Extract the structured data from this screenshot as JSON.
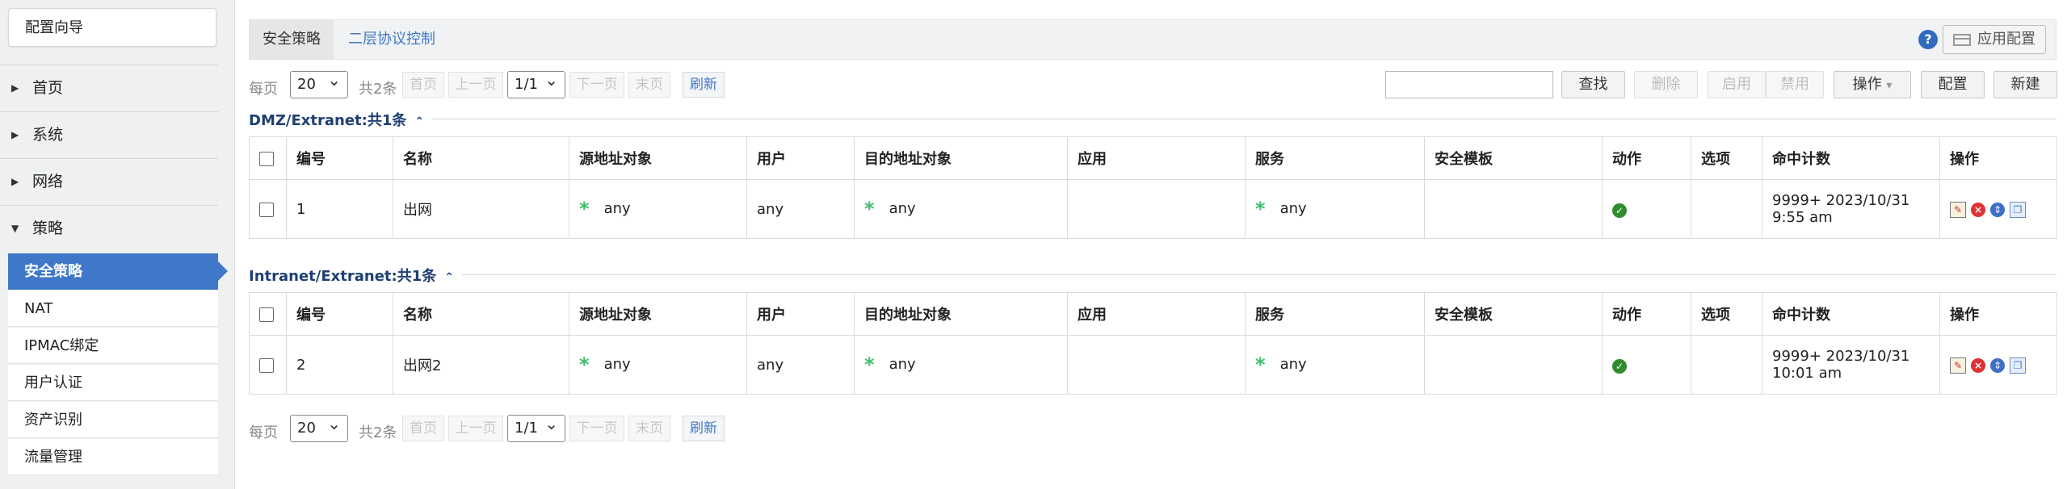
{
  "sidebar": {
    "wizard": "配置向导",
    "items": [
      {
        "label": "首页",
        "arrow": "▶"
      },
      {
        "label": "系统",
        "arrow": "▶"
      },
      {
        "label": "网络",
        "arrow": "▶"
      },
      {
        "label": "策略",
        "arrow": "▼"
      }
    ],
    "subitems": [
      "安全策略",
      "NAT",
      "IPMAC绑定",
      "用户认证",
      "资产识别",
      "流量管理"
    ]
  },
  "tabs": {
    "security_policy": "安全策略",
    "layer2": "二层协议控制"
  },
  "header": {
    "help": "?",
    "apply_config": "应用配置"
  },
  "pager": {
    "per_page_label": "每页",
    "per_page": "20",
    "total": "共2条",
    "first": "首页",
    "prev": "上一页",
    "page": "1/1",
    "next": "下一页",
    "last": "末页",
    "refresh": "刷新"
  },
  "toolbar": {
    "search_value": "",
    "find": "查找",
    "delete": "删除",
    "enable": "启用",
    "disable": "禁用",
    "operation": "操作",
    "operation_arrow": "▾",
    "config": "配置",
    "new": "新建"
  },
  "columns": [
    "编号",
    "名称",
    "源地址对象",
    "用户",
    "目的地址对象",
    "应用",
    "服务",
    "安全模板",
    "动作",
    "选项",
    "命中计数",
    "操作"
  ],
  "groups": [
    {
      "title": "DMZ/Extranet:共1条",
      "rows": [
        {
          "id": "1",
          "name": "出网",
          "src": "any",
          "user": "any",
          "dst": "any",
          "app": "",
          "service": "any",
          "template": "",
          "action_icon": "check-circle-icon",
          "option": "",
          "hits_line1": "9999+ 2023/10/31",
          "hits_line2": "9:55 am"
        }
      ]
    },
    {
      "title": "Intranet/Extranet:共1条",
      "rows": [
        {
          "id": "2",
          "name": "出网2",
          "src": "any",
          "user": "any",
          "dst": "any",
          "app": "",
          "service": "any",
          "template": "",
          "action_icon": "check-circle-icon",
          "option": "",
          "hits_line1": "9999+ 2023/10/31",
          "hits_line2": "10:01 am"
        }
      ]
    }
  ],
  "colors": {
    "accent": "#3f78c9",
    "group_title": "#1f3f73",
    "any_star": "#3fbf6a",
    "action_ok": "#2f8d2f"
  }
}
